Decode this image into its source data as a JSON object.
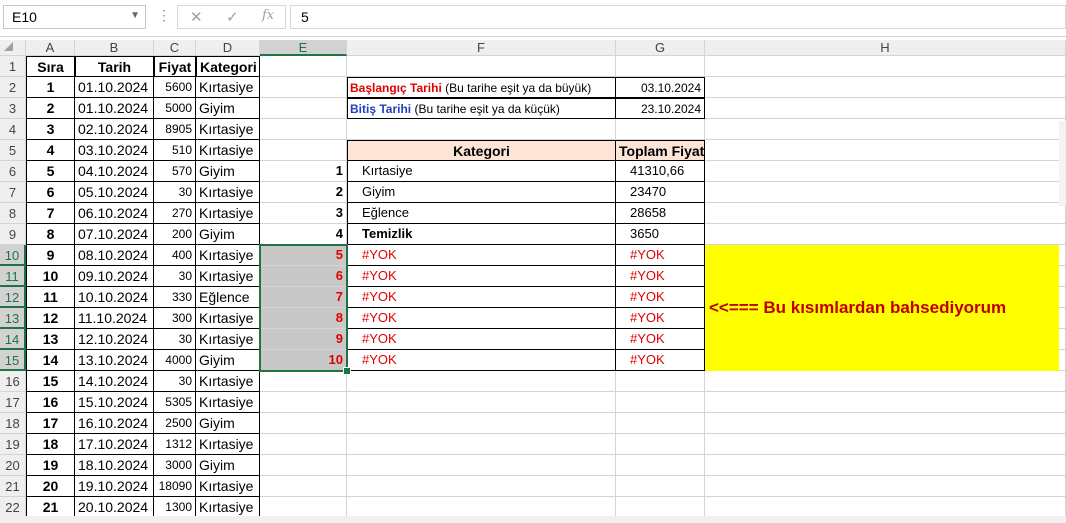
{
  "formula_bar": {
    "name_box": "E10",
    "cancel_icon": "✕",
    "enter_icon": "✓",
    "fx_icon": "fx",
    "formula": "5"
  },
  "columns": [
    "A",
    "B",
    "C",
    "D",
    "E",
    "F",
    "G",
    "H"
  ],
  "rows": [
    "1",
    "2",
    "3",
    "4",
    "5",
    "6",
    "7",
    "8",
    "9",
    "10",
    "11",
    "12",
    "13",
    "14",
    "15",
    "16",
    "17",
    "18",
    "19",
    "20",
    "21",
    "22"
  ],
  "headers": {
    "sira": "Sıra",
    "tarih": "Tarih",
    "fiyat": "Fiyat",
    "kategori": "Kategori"
  },
  "records": [
    {
      "sira": "1",
      "tarih": "01.10.2024",
      "fiyat": "5600",
      "kategori": "Kırtasiye"
    },
    {
      "sira": "2",
      "tarih": "01.10.2024",
      "fiyat": "5000",
      "kategori": "Giyim"
    },
    {
      "sira": "3",
      "tarih": "02.10.2024",
      "fiyat": "8905",
      "kategori": "Kırtasiye"
    },
    {
      "sira": "4",
      "tarih": "03.10.2024",
      "fiyat": "510",
      "kategori": "Kırtasiye"
    },
    {
      "sira": "5",
      "tarih": "04.10.2024",
      "fiyat": "570",
      "kategori": "Giyim"
    },
    {
      "sira": "6",
      "tarih": "05.10.2024",
      "fiyat": "30",
      "kategori": "Kırtasiye"
    },
    {
      "sira": "7",
      "tarih": "06.10.2024",
      "fiyat": "270",
      "kategori": "Kırtasiye"
    },
    {
      "sira": "8",
      "tarih": "07.10.2024",
      "fiyat": "200",
      "kategori": "Giyim"
    },
    {
      "sira": "9",
      "tarih": "08.10.2024",
      "fiyat": "400",
      "kategori": "Kırtasiye"
    },
    {
      "sira": "10",
      "tarih": "09.10.2024",
      "fiyat": "30",
      "kategori": "Kırtasiye"
    },
    {
      "sira": "11",
      "tarih": "10.10.2024",
      "fiyat": "330",
      "kategori": "Eğlence"
    },
    {
      "sira": "12",
      "tarih": "11.10.2024",
      "fiyat": "300",
      "kategori": "Kırtasiye"
    },
    {
      "sira": "13",
      "tarih": "12.10.2024",
      "fiyat": "30",
      "kategori": "Kırtasiye"
    },
    {
      "sira": "14",
      "tarih": "13.10.2024",
      "fiyat": "4000",
      "kategori": "Giyim"
    },
    {
      "sira": "15",
      "tarih": "14.10.2024",
      "fiyat": "30",
      "kategori": "Kırtasiye"
    },
    {
      "sira": "16",
      "tarih": "15.10.2024",
      "fiyat": "5305",
      "kategori": "Kırtasiye"
    },
    {
      "sira": "17",
      "tarih": "16.10.2024",
      "fiyat": "2500",
      "kategori": "Giyim"
    },
    {
      "sira": "18",
      "tarih": "17.10.2024",
      "fiyat": "1312",
      "kategori": "Kırtasiye"
    },
    {
      "sira": "19",
      "tarih": "18.10.2024",
      "fiyat": "3000",
      "kategori": "Giyim"
    },
    {
      "sira": "20",
      "tarih": "19.10.2024",
      "fiyat": "18090",
      "kategori": "Kırtasiye"
    },
    {
      "sira": "21",
      "tarih": "20.10.2024",
      "fiyat": "1300",
      "kategori": "Kırtasiye"
    }
  ],
  "criteria": {
    "start_label": "Başlangıç Tarihi",
    "start_note": " (Bu tarihe eşit ya da büyük)",
    "start_value": "03.10.2024",
    "end_label": "Bitiş Tarihi",
    "end_note": " (Bu tarihe eşit ya da küçük)",
    "end_value": "23.10.2024"
  },
  "summary": {
    "header_kategori": "Kategori",
    "header_toplam": "Toplam Fiyat",
    "rows": [
      {
        "no": "1",
        "kategori": "Kırtasiye",
        "toplam": "41310,66"
      },
      {
        "no": "2",
        "kategori": "Giyim",
        "toplam": "23470"
      },
      {
        "no": "3",
        "kategori": "Eğlence",
        "toplam": "28658"
      },
      {
        "no": "4",
        "kategori": "Temizlik",
        "toplam": "3650"
      },
      {
        "no": "5",
        "kategori": "#YOK",
        "toplam": "#YOK"
      },
      {
        "no": "6",
        "kategori": "#YOK",
        "toplam": "#YOK"
      },
      {
        "no": "7",
        "kategori": "#YOK",
        "toplam": "#YOK"
      },
      {
        "no": "8",
        "kategori": "#YOK",
        "toplam": "#YOK"
      },
      {
        "no": "9",
        "kategori": "#YOK",
        "toplam": "#YOK"
      },
      {
        "no": "10",
        "kategori": "#YOK",
        "toplam": "#YOK"
      }
    ]
  },
  "annotation": "<<=== Bu kısımlardan bahsediyorum",
  "colors": {
    "accent": "#217346",
    "error": "#e00000",
    "highlight": "#ffff00",
    "header_fill": "#fce4d6"
  }
}
